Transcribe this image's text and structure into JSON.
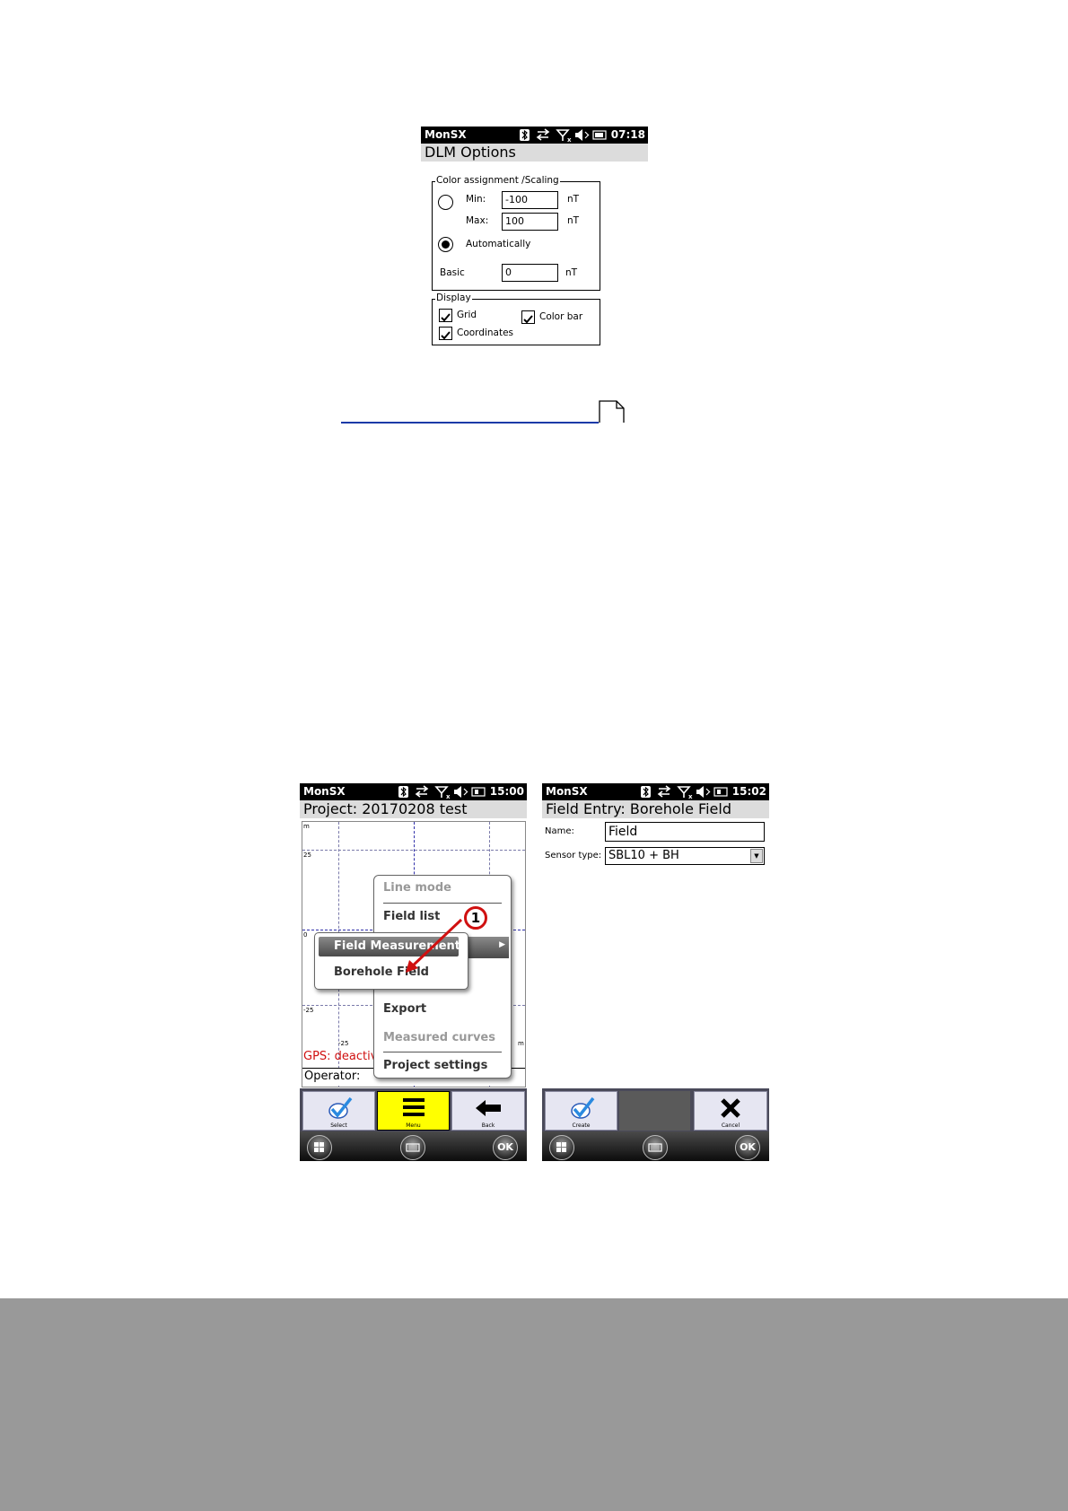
{
  "screen1": {
    "app": "MonSX",
    "time": "07:18",
    "title": "DLM Options",
    "color_group": {
      "legend": "Color assignment /Scaling",
      "min_label": "Min:",
      "min_value": "-100",
      "max_label": "Max:",
      "max_value": "100",
      "unit": "nT",
      "auto_label": "Automatically",
      "basic_label": "Basic",
      "basic_value": "0"
    },
    "display_group": {
      "legend": "Display",
      "grid": "Grid",
      "colorbar": "Color bar",
      "coordinates": "Coordinates"
    }
  },
  "screen2": {
    "app": "MonSX",
    "time": "15:00",
    "title": "Project: 20170208 test",
    "axis_labels": [
      "m",
      "25",
      "0",
      "-25",
      "-25",
      "m"
    ],
    "gps_text": "GPS: deactiva",
    "operator_label": "Operator:",
    "menu_items": [
      "Line mode",
      "Field list",
      "Export",
      "Measured curves",
      "Project settings"
    ],
    "submenu_items": [
      "Field Measurement",
      "Borehole Field"
    ],
    "callout_number": "1",
    "toolbar": [
      "Select",
      "Menu",
      "Back"
    ],
    "winbar_ok": "OK"
  },
  "screen3": {
    "app": "MonSX",
    "time": "15:02",
    "title": "Field Entry: Borehole Field",
    "name_label": "Name:",
    "name_value": "Field",
    "sensor_label": "Sensor type:",
    "sensor_value": "SBL10 + BH",
    "toolbar": [
      "Create",
      "Cancel"
    ],
    "winbar_ok": "OK"
  },
  "colors": {
    "footer": "#999999",
    "highlight_yellow": "#ffff00",
    "callout_red": "#d01010",
    "gps_red": "#d01010"
  }
}
